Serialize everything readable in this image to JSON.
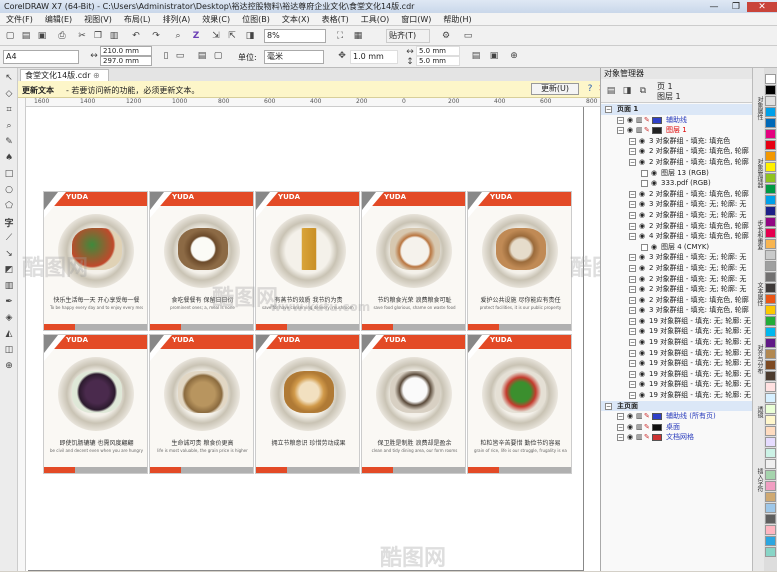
{
  "window": {
    "title": "CorelDRAW X7 (64-Bit) - C:\\Users\\Administrator\\Desktop\\裕达控股物料\\裕达尊府企业文化\\食堂文化14版.cdr",
    "min": "—",
    "max": "❐",
    "close": "✕"
  },
  "menu": [
    "文件(F)",
    "编辑(E)",
    "视图(V)",
    "布局(L)",
    "排列(A)",
    "效果(C)",
    "位图(B)",
    "文本(X)",
    "表格(T)",
    "工具(O)",
    "窗口(W)",
    "帮助(H)"
  ],
  "toolbar": {
    "zoom": "8%",
    "snap": "贴齐(T)"
  },
  "propbar": {
    "paper": "A4",
    "width": "210.0 mm",
    "height": "297.0 mm",
    "unit_label": "单位:",
    "unit": "毫米",
    "nudge": "1.0 mm",
    "dup_x": "5.0 mm",
    "dup_y": "5.0 mm"
  },
  "doc": {
    "tab": "食堂文化14版.cdr"
  },
  "infobar": {
    "bold": "更新文本",
    "message": "- 若要访问新的功能，必须更新文本。",
    "button": "更新(U)"
  },
  "ruler": [
    "1600",
    "1400",
    "1200",
    "1000",
    "800",
    "600",
    "400",
    "200",
    "0",
    "200",
    "400",
    "600",
    "800"
  ],
  "cards": [
    {
      "brand": "YUDA",
      "cap": "快乐生活每一天 开心享受每一餐",
      "sub": "To be happy every day and to enjoy every meal"
    },
    {
      "brand": "YUDA",
      "cap": "食吃餐餐有 保留日日衍",
      "sub": "prominent ones; a, meal is none"
    },
    {
      "brand": "YUDA",
      "cap": "有蒸节约效质 我节约为责",
      "sub": "save for have conserving delivery, mushroom ends"
    },
    {
      "brand": "YUDA",
      "cap": "节约粮食光荣 浪费粮食可耻",
      "sub": "save food glorious, shame on waste food"
    },
    {
      "brand": "YUDA",
      "cap": "爱护公共设施 尽你能应有责任",
      "sub": "protect facilities, it is our public property"
    },
    {
      "brand": "YUDA",
      "cap": "即使饥肠辘辘 也需风度翩翩",
      "sub": "be civil and decent even when you are hungry"
    },
    {
      "brand": "YUDA",
      "cap": "生命诚可贵 粮食价更高",
      "sub": "life is most valuable, the grain price is higher"
    },
    {
      "brand": "YUDA",
      "cap": "拥立节粮意识 珍惜劳动成果",
      "sub": ""
    },
    {
      "brand": "YUDA",
      "cap": "保卫胜是制胜 浪费却是盈余",
      "sub": "clean and tidy dining area, our form rooms"
    },
    {
      "brand": "YUDA",
      "cap": "粒粒皆辛苦要惜 勤俭节约容易",
      "sub": "grain of rice, life is our struggle, frugality is easy"
    }
  ],
  "panel": {
    "title": "对象管理器",
    "page": "页 1",
    "layer": "图层 1"
  },
  "tree": [
    {
      "t": "页面 1",
      "sec": true,
      "ind": 0,
      "c": null
    },
    {
      "t": "辅助线",
      "ind": 1,
      "c": "#2f40c8",
      "blue": true
    },
    {
      "t": "图层 1",
      "ind": 1,
      "c": "#222",
      "red": true
    },
    {
      "t": "3 对象群组 - 填充: 填充色",
      "ind": 2,
      "c": null
    },
    {
      "t": "2 对象群组 - 填充: 填充色, 轮廓",
      "ind": 2,
      "c": null
    },
    {
      "t": "2 对象群组 - 填充: 填充色, 轮廓",
      "ind": 2,
      "c": null
    },
    {
      "t": "图层 13 (RGB)",
      "ind": 3,
      "c": null
    },
    {
      "t": "333.pdf (RGB)",
      "ind": 3,
      "c": null
    },
    {
      "t": "2 对象群组 - 填充: 填充色, 轮廓",
      "ind": 2,
      "c": null
    },
    {
      "t": "3 对象群组 - 填充: 无; 轮廓: 无",
      "ind": 2,
      "c": null
    },
    {
      "t": "2 对象群组 - 填充: 无; 轮廓: 无",
      "ind": 2,
      "c": null
    },
    {
      "t": "2 对象群组 - 填充: 填充色, 轮廓",
      "ind": 2,
      "c": null
    },
    {
      "t": "4 对象群组 - 填充: 填充色, 轮廓",
      "ind": 2,
      "c": null
    },
    {
      "t": "图层 4 (CMYK)",
      "ind": 3,
      "c": null
    },
    {
      "t": "3 对象群组 - 填充: 无; 轮廓: 无",
      "ind": 2,
      "c": null
    },
    {
      "t": "2 对象群组 - 填充: 无; 轮廓: 无",
      "ind": 2,
      "c": null
    },
    {
      "t": "2 对象群组 - 填充: 无; 轮廓: 无",
      "ind": 2,
      "c": null
    },
    {
      "t": "2 对象群组 - 填充: 无; 轮廓: 无",
      "ind": 2,
      "c": null
    },
    {
      "t": "2 对象群组 - 填充: 填充色, 轮廓",
      "ind": 2,
      "c": null
    },
    {
      "t": "3 对象群组 - 填充: 填充色, 轮廓",
      "ind": 2,
      "c": null
    },
    {
      "t": "19 对象群组 - 填充: 无; 轮廓: 无",
      "ind": 2,
      "c": null
    },
    {
      "t": "19 对象群组 - 填充: 无; 轮廓: 无",
      "ind": 2,
      "c": null
    },
    {
      "t": "19 对象群组 - 填充: 无; 轮廓: 无",
      "ind": 2,
      "c": null
    },
    {
      "t": "19 对象群组 - 填充: 无; 轮廓: 无",
      "ind": 2,
      "c": null
    },
    {
      "t": "19 对象群组 - 填充: 无; 轮廓: 无",
      "ind": 2,
      "c": null
    },
    {
      "t": "19 对象群组 - 填充: 无; 轮廓: 无",
      "ind": 2,
      "c": null
    },
    {
      "t": "19 对象群组 - 填充: 无; 轮廓: 无",
      "ind": 2,
      "c": null
    },
    {
      "t": "19 对象群组 - 填充: 无; 轮廓: 无",
      "ind": 2,
      "c": null
    },
    {
      "t": "主页面",
      "sec": true,
      "ind": 0,
      "c": null
    },
    {
      "t": "辅助线 (所有页)",
      "ind": 1,
      "c": "#2f40c8",
      "blue": true
    },
    {
      "t": "桌面",
      "ind": 1,
      "c": "#111",
      "blue": true
    },
    {
      "t": "文档网格",
      "ind": 1,
      "c": "#c33",
      "blue": true
    }
  ],
  "sidetabs": [
    "对象属性",
    "对象管理器",
    "步长和重复",
    "文本属性",
    "对齐与分布",
    "透镜",
    "插入字符"
  ],
  "palette": [
    "#ffffff",
    "#000000",
    "#e0e0e0",
    "#00a0e9",
    "#0068b7",
    "#e4007f",
    "#e60012",
    "#f39800",
    "#fff100",
    "#8fc31f",
    "#009944",
    "#00a0e9",
    "#1d2088",
    "#920783",
    "#e5004f",
    "#f8b551",
    "#c9caca",
    "#9fa0a0",
    "#727171",
    "#3e3a39",
    "#ea5514",
    "#fcc800",
    "#22ac38",
    "#00b7ee",
    "#601986",
    "#b28850",
    "#7d4a22",
    "#4c3b2e",
    "#ffe1e1",
    "#d7f0ff",
    "#eaffd6",
    "#fff7cc",
    "#ffdcc0",
    "#e6dcff",
    "#ccf2e6",
    "#f0f0f0",
    "#a5d4ad",
    "#f19ec2",
    "#cfa972",
    "#9ec7e8",
    "#5e5e5e",
    "#ffb6c1",
    "#2ca6e0",
    "#88d5c7"
  ],
  "watermark": "酷图网",
  "watermark_url": "www.kutu.com"
}
